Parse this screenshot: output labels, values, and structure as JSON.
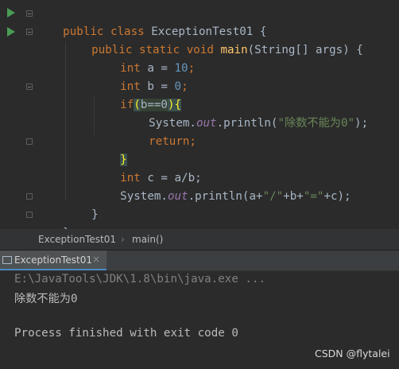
{
  "editor": {
    "lines": [
      {
        "t1": "public class ",
        "t2": "ExceptionTest01 {"
      },
      {
        "t1": "public static void ",
        "t2": "main",
        "t3": "(String[] args) {"
      },
      {
        "t1": "int ",
        "t2": "a = ",
        "t3": "10",
        "t4": ";"
      },
      {
        "t1": "int ",
        "t2": "b = ",
        "t3": "0",
        "t4": ";"
      },
      {
        "t1": "if",
        "t2": "(",
        "t3": "b==0",
        "t4": ")",
        "t5": "{"
      },
      {
        "t1": "System.",
        "t2": "out",
        "t3": ".println(",
        "t4": "\"除数不能为0\"",
        "t5": ");"
      },
      {
        "t1": "return",
        "t2": ";"
      },
      {
        "t1": "}"
      },
      {
        "t1": "int ",
        "t2": "c = a/b;"
      },
      {
        "t1": "System.",
        "t2": "out",
        "t3": ".println(a+",
        "t4": "\"/\"",
        "t5": "+b+",
        "t6": "\"=\"",
        "t7": "+c);"
      },
      {
        "t1": "}"
      },
      {
        "t1": "}"
      }
    ],
    "colors": {
      "keyword": "#cc7832",
      "number": "#6897bb",
      "string": "#6a8759",
      "function": "#ffc66d",
      "field": "#9876aa",
      "text": "#a9b7c6",
      "run": "#499c54"
    }
  },
  "breadcrumb": {
    "class_name": "ExceptionTest01",
    "separator": "›",
    "method": "main()"
  },
  "run_tab": {
    "label": "ExceptionTest01",
    "close": "×"
  },
  "console": {
    "command": "E:\\JavaTools\\JDK\\1.8\\bin\\java.exe ...",
    "output": "除数不能为0",
    "exit": "Process finished with exit code 0"
  },
  "watermark": "CSDN @flytalei"
}
